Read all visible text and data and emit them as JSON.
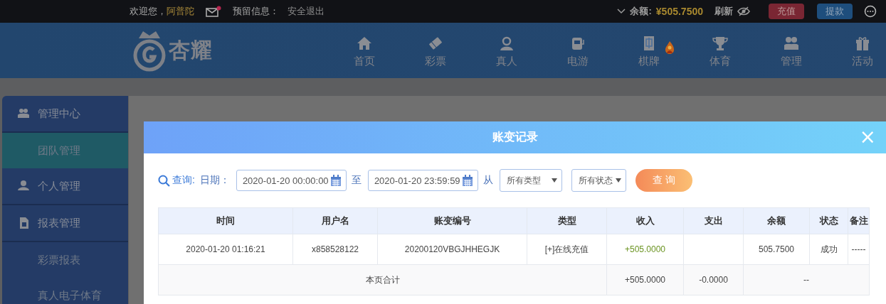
{
  "top_bar": {
    "welcome": "欢迎您，",
    "username": "阿普陀",
    "mail_unread": true,
    "reserved_label": "预留信息：",
    "logout": "安全退出",
    "balance_label": "余额:",
    "balance": "¥505.7500",
    "refresh": "刷新",
    "deposit": "充值",
    "withdraw": "提款"
  },
  "logo": {
    "text": "杏耀"
  },
  "nav": [
    {
      "label": "首页",
      "kind": "home",
      "hot": false
    },
    {
      "label": "彩票",
      "kind": "ticket",
      "hot": false
    },
    {
      "label": "真人",
      "kind": "dealer",
      "hot": false
    },
    {
      "label": "电游",
      "kind": "slot",
      "hot": false
    },
    {
      "label": "棋牌",
      "kind": "mahjong",
      "hot": true
    },
    {
      "label": "体育",
      "kind": "trophy",
      "hot": false
    },
    {
      "label": "管理",
      "kind": "users",
      "hot": false
    },
    {
      "label": "活动",
      "kind": "gift",
      "hot": false
    }
  ],
  "sidebar": {
    "items": [
      {
        "label": "管理中心",
        "kind": "users",
        "selected": false,
        "children": [
          {
            "label": "团队管理",
            "selected": true
          }
        ]
      },
      {
        "label": "个人管理",
        "kind": "user",
        "selected": false
      },
      {
        "label": "报表管理",
        "kind": "doc",
        "selected": false,
        "children": [
          {
            "label": "彩票报表",
            "selected": false
          },
          {
            "label": "真人电子体育",
            "selected": false
          }
        ]
      }
    ]
  },
  "modal": {
    "title": "账变记录",
    "close": "×",
    "filter": {
      "query_label": "查询:",
      "date_label": "日期：",
      "start": "2020-01-20 00:00:00",
      "to": "至",
      "end": "2020-01-20 23:59:59",
      "from": "从",
      "type_select": "所有类型",
      "status_select": "所有状态",
      "button": "查 询"
    },
    "table": {
      "columns": [
        "时间",
        "用户名",
        "账变编号",
        "类型",
        "收入",
        "支出",
        "余额",
        "状态",
        "备注"
      ],
      "rows": [
        [
          "2020-01-20 01:16:21",
          "x858528122",
          "20200120VBGJHHEGJK",
          "[+]在线充值",
          "+505.0000",
          "",
          "505.7500",
          "成功",
          "-----"
        ]
      ],
      "total": {
        "label": "本页合计",
        "income": "+505.0000",
        "expense": "-0.0000",
        "rest": "--"
      }
    }
  }
}
